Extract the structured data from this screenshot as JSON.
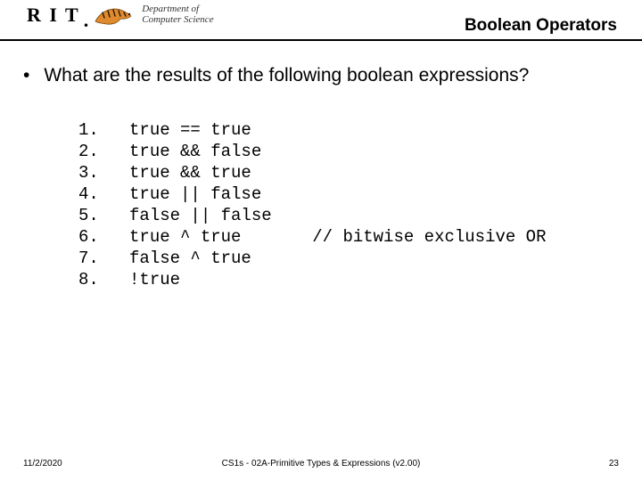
{
  "header": {
    "org_abbrev": "R I T",
    "dept_line1": "Department of",
    "dept_line2": "Computer Science",
    "title": "Boolean Operators"
  },
  "body": {
    "question": "What are the results of the following boolean expressions?",
    "code": "1.   true == true\n2.   true && false\n3.   true && true\n4.   true || false\n5.   false || false\n6.   true ^ true       // bitwise exclusive OR\n7.   false ^ true\n8.   !true"
  },
  "footer": {
    "date": "11/2/2020",
    "center": "CS1s - 02A-Primitive Types & Expressions (v2.00)",
    "page": "23"
  }
}
